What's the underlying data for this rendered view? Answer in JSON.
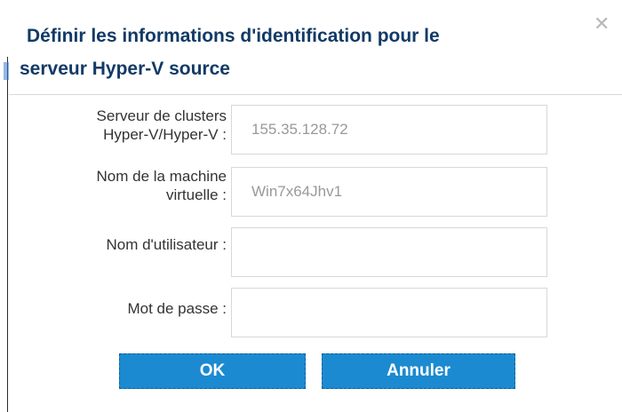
{
  "dialog": {
    "title_line1": "Définir les informations d'identification pour le",
    "title_line2": "serveur Hyper-V source",
    "close_symbol": "✕",
    "icons": {
      "close": "close-icon"
    }
  },
  "fields": [
    {
      "label_line1": "Serveur de clusters",
      "label_line2": "Hyper-V/Hyper-V :",
      "value": "155.35.128.72",
      "placeholder": ""
    },
    {
      "label_line1": "Nom de la machine",
      "label_line2": "virtuelle :",
      "value": "Win7x64Jhv1",
      "placeholder": ""
    },
    {
      "label_line1": "Nom d'utilisateur :",
      "label_line2": "",
      "value": "",
      "placeholder": ""
    },
    {
      "label_line1": "Mot de passe :",
      "label_line2": "",
      "value": "",
      "placeholder": ""
    }
  ],
  "buttons": {
    "ok_label": "OK",
    "cancel_label": "Annuler"
  },
  "colors": {
    "title_color": "#123a66",
    "button_color": "#1c8ad0",
    "text_color": "#333333",
    "input_border": "#d8d8d8"
  }
}
